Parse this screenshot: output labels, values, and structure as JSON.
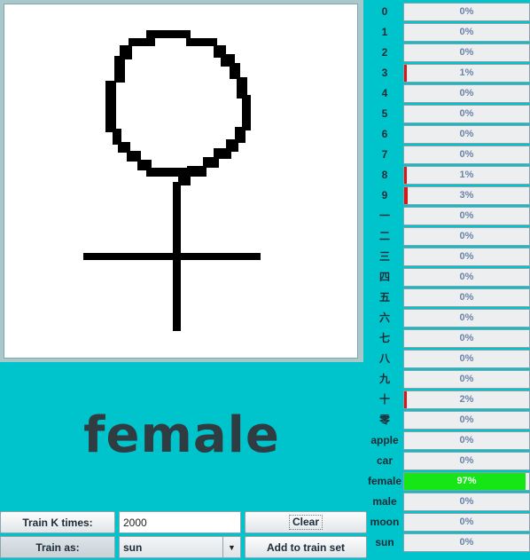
{
  "prediction": "female",
  "drawing": {
    "ink_color": "#000000",
    "symbol": "female-symbol"
  },
  "controls": {
    "train_k_label": "Train K times:",
    "train_k_value": "2000",
    "clear_label": "Clear",
    "train_as_label": "Train as:",
    "train_as_value": "sun",
    "add_label": "Add to train set"
  },
  "colors": {
    "background": "#00c4cc",
    "winning_bar": "#16e616",
    "bar_marker": "#d21a1a"
  },
  "results": [
    {
      "label": "0",
      "percent": 0,
      "text": "0%"
    },
    {
      "label": "1",
      "percent": 0,
      "text": "0%"
    },
    {
      "label": "2",
      "percent": 0,
      "text": "0%"
    },
    {
      "label": "3",
      "percent": 1,
      "text": "1%"
    },
    {
      "label": "4",
      "percent": 0,
      "text": "0%"
    },
    {
      "label": "5",
      "percent": 0,
      "text": "0%"
    },
    {
      "label": "6",
      "percent": 0,
      "text": "0%"
    },
    {
      "label": "7",
      "percent": 0,
      "text": "0%"
    },
    {
      "label": "8",
      "percent": 1,
      "text": "1%"
    },
    {
      "label": "9",
      "percent": 3,
      "text": "3%"
    },
    {
      "label": "一",
      "percent": 0,
      "text": "0%"
    },
    {
      "label": "二",
      "percent": 0,
      "text": "0%"
    },
    {
      "label": "三",
      "percent": 0,
      "text": "0%"
    },
    {
      "label": "四",
      "percent": 0,
      "text": "0%"
    },
    {
      "label": "五",
      "percent": 0,
      "text": "0%"
    },
    {
      "label": "六",
      "percent": 0,
      "text": "0%"
    },
    {
      "label": "七",
      "percent": 0,
      "text": "0%"
    },
    {
      "label": "八",
      "percent": 0,
      "text": "0%"
    },
    {
      "label": "九",
      "percent": 0,
      "text": "0%"
    },
    {
      "label": "十",
      "percent": 2,
      "text": "2%"
    },
    {
      "label": "零",
      "percent": 0,
      "text": "0%"
    },
    {
      "label": "apple",
      "percent": 0,
      "text": "0%"
    },
    {
      "label": "car",
      "percent": 0,
      "text": "0%"
    },
    {
      "label": "female",
      "percent": 97,
      "text": "97%",
      "winner": true
    },
    {
      "label": "male",
      "percent": 0,
      "text": "0%"
    },
    {
      "label": "moon",
      "percent": 0,
      "text": "0%"
    },
    {
      "label": "sun",
      "percent": 0,
      "text": "0%"
    }
  ]
}
